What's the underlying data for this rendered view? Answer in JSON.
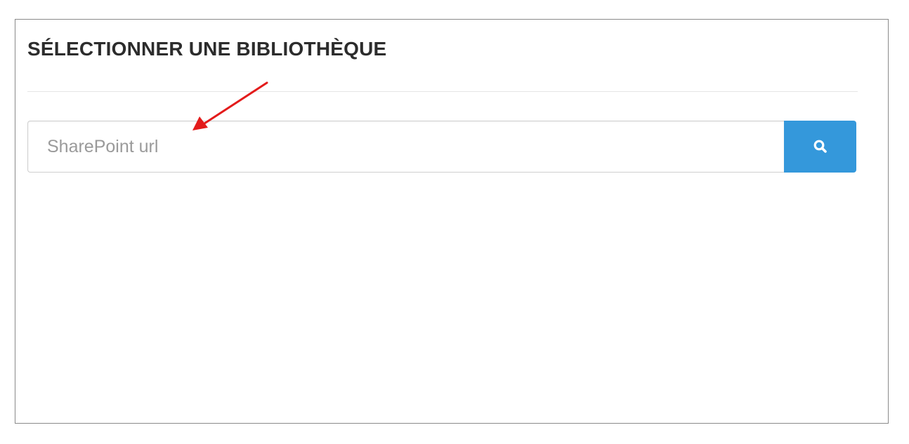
{
  "panel": {
    "title": "SÉLECTIONNER UNE BIBLIOTHÈQUE"
  },
  "search": {
    "placeholder": "SharePoint url",
    "value": "",
    "button_icon": "search-icon"
  },
  "annotation": {
    "icon": "arrow-pointer",
    "color": "#e31b1b"
  },
  "colors": {
    "accent": "#3498db",
    "border": "#8a8a8a",
    "title": "#2c2c2c"
  }
}
